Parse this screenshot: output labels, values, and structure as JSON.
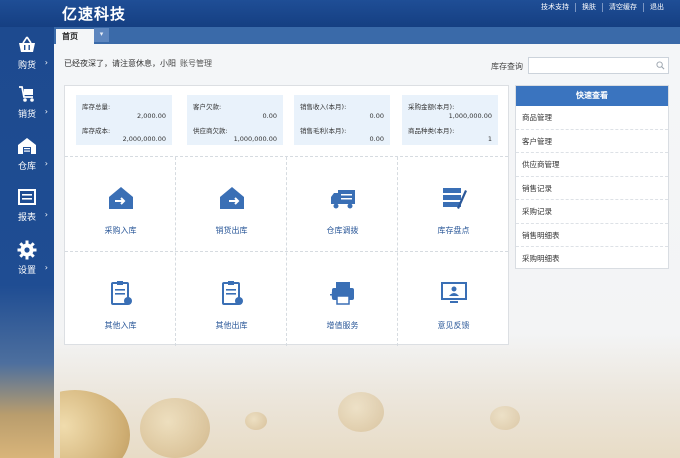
{
  "app": {
    "title": "亿速科技"
  },
  "top_links": [
    "技术支持",
    "换肤",
    "清空缓存",
    "退出"
  ],
  "sidebar": {
    "items": [
      {
        "label": "购货",
        "icon": "basket-icon"
      },
      {
        "label": "销货",
        "icon": "cart-icon"
      },
      {
        "label": "仓库",
        "icon": "warehouse-icon"
      },
      {
        "label": "报表",
        "icon": "report-icon"
      },
      {
        "label": "设置",
        "icon": "gear-icon"
      }
    ],
    "chevron": "›"
  },
  "tabs": {
    "home": "首页",
    "dropdown": "▾"
  },
  "greeting": {
    "text": "已经夜深了，请注意休息，小阳",
    "account_link": "账号管理"
  },
  "search": {
    "label": "库存查询",
    "value": "",
    "placeholder": ""
  },
  "stats": [
    {
      "k1": "库存总量:",
      "v1": "2,000.00",
      "k2": "库存成本:",
      "v2": "2,000,000.00"
    },
    {
      "k1": "客户欠款:",
      "v1": "0.00",
      "k2": "供应商欠款:",
      "v2": "1,000,000.00"
    },
    {
      "k1": "销售收入(本月):",
      "v1": "0.00",
      "k2": "销售毛利(本月):",
      "v2": "0.00"
    },
    {
      "k1": "采购金额(本月):",
      "v1": "1,000,000.00",
      "k2": "商品种类(本月):",
      "v2": "1"
    }
  ],
  "actions": [
    {
      "label": "采购入库",
      "icon": "house-in-icon"
    },
    {
      "label": "销货出库",
      "icon": "house-out-icon"
    },
    {
      "label": "仓库调拨",
      "icon": "truck-icon"
    },
    {
      "label": "库存盘点",
      "icon": "inventory-edit-icon"
    },
    {
      "label": "其他入库",
      "icon": "clipboard-in-icon"
    },
    {
      "label": "其他出库",
      "icon": "clipboard-out-icon"
    },
    {
      "label": "增值服务",
      "icon": "printer-icon"
    },
    {
      "label": "意见反馈",
      "icon": "monitor-user-icon"
    }
  ],
  "quick_view": {
    "title": "快速查看",
    "items": [
      "商品管理",
      "客户管理",
      "供应商管理",
      "销售记录",
      "采购记录",
      "销售明细表",
      "采购明细表"
    ]
  },
  "colors": {
    "brand": "#1f4e96",
    "accent": "#3a74bf",
    "icon": "#3a6fb5"
  }
}
